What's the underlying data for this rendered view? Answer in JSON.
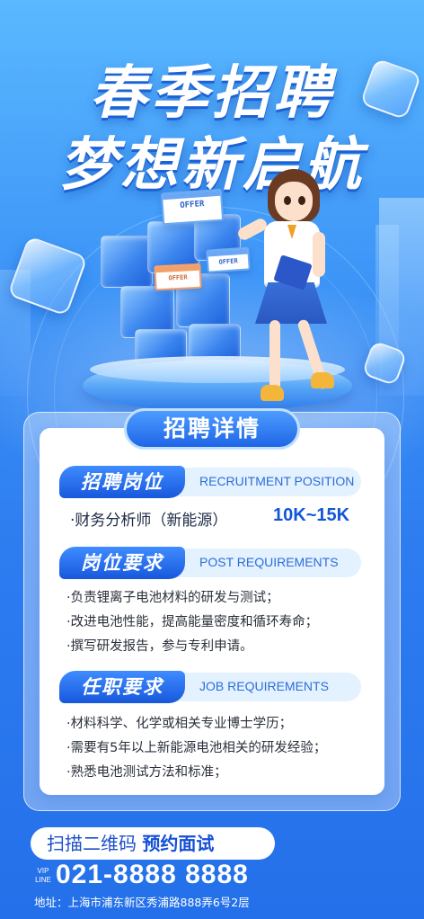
{
  "title": {
    "line1": "春季招聘",
    "line2": "梦想新启航"
  },
  "offer_cards": [
    "OFFER",
    "OFFER",
    "OFFER"
  ],
  "card": {
    "heading": "招聘详情"
  },
  "sections": [
    {
      "tag": "招聘岗位",
      "en": "RECRUITMENT POSITION"
    },
    {
      "tag": "岗位要求",
      "en": "POST REQUIREMENTS"
    },
    {
      "tag": "任职要求",
      "en": "JOB REQUIREMENTS"
    }
  ],
  "position": {
    "title": "·财务分析师（新能源）",
    "salary": "10K~15K"
  },
  "post_requirements": [
    "·负责锂离子电池材料的研发与测试；",
    "·改进电池性能，提高能量密度和循环寿命；",
    "·撰写研发报告，参与专利申请。"
  ],
  "job_requirements": [
    "·材料科学、化学或相关专业博士学历；",
    "·需要有5年以上新能源电池相关的研发经验；",
    "·熟悉电池测试方法和标准；"
  ],
  "footer": {
    "scan_text": "扫描二维码",
    "scan_emphasis": "预约面试",
    "vip_label_1": "VIP",
    "vip_label_2": "LINE",
    "phone": "021-8888 8888",
    "address": "地址：上海市浦东新区秀浦路888弄6号2层"
  },
  "colors": {
    "accent": "#1f66e6",
    "background": "#3d95f7",
    "salary": "#1257d8"
  }
}
